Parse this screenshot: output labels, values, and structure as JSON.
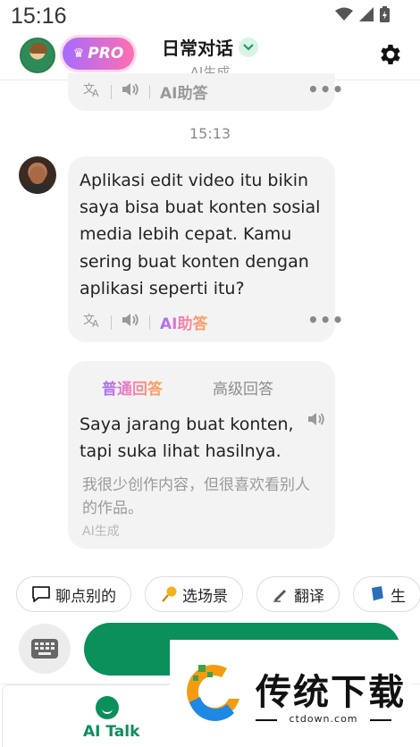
{
  "status_bar": {
    "time": "15:16"
  },
  "header": {
    "pro_label": "PRO",
    "title": "日常对话",
    "subtitle": "AI生成"
  },
  "previous_message": {
    "ai_assist_label": "AI助答"
  },
  "timestamp": "15:13",
  "message": {
    "text": "Aplikasi edit video itu bikin saya bisa buat konten sosial media lebih cepat. Kamu sering buat konten dengan aplikasi seperti itu?",
    "ai_assist_label": "AI助答"
  },
  "answer_card": {
    "tab_normal": "普通回答",
    "tab_advanced": "高级回答",
    "answer": "Saya jarang buat konten, tapi suka lihat hasilnya.",
    "translation": "我很少创作内容，但很喜欢看别人的作品。",
    "generated_tag": "AI生成"
  },
  "chips": [
    {
      "icon": "chat-bubble-icon",
      "label": "聊点别的"
    },
    {
      "icon": "pin-icon",
      "label": "选场景"
    },
    {
      "icon": "pen-icon",
      "label": "翻译"
    },
    {
      "icon": "book-icon",
      "label": "生"
    }
  ],
  "bottom_nav": {
    "ai_talk_label": "AI Talk"
  },
  "watermark": {
    "brand": "传统下载",
    "url": "ctdown.com"
  },
  "colors": {
    "accent": "#0b8f5b",
    "pro_gradient_start": "#a56cff",
    "pro_gradient_end": "#ff6fae"
  }
}
